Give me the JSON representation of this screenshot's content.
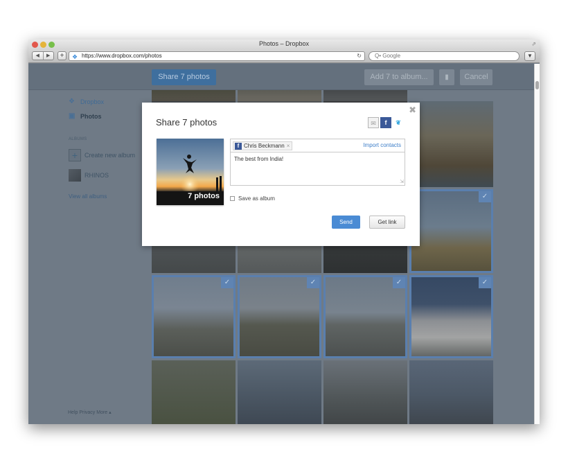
{
  "window": {
    "title": "Photos – Dropbox",
    "url": "https://www.dropbox.com/photos",
    "search_placeholder": "Q• Google"
  },
  "topbar": {
    "share_label": "Share 7 photos",
    "add_album_label": "Add 7 to album...",
    "cancel_label": "Cancel"
  },
  "sidebar": {
    "dropbox_label": "Dropbox",
    "photos_label": "Photos",
    "albums_heading": "ALBUMS",
    "create_album_label": "Create new album",
    "album_name": "RHINOS",
    "view_all_label": "View all albums",
    "footer": "Help  Privacy  More  ▴"
  },
  "modal": {
    "title": "Share 7 photos",
    "photo_caption": "7 photos",
    "recipient": "Chris Beckmann",
    "import_contacts": "Import contacts",
    "message": "The best from India!",
    "save_album_label": "Save as album",
    "send_label": "Send",
    "get_link_label": "Get link"
  },
  "colors": {
    "accent": "#4a8bd4",
    "facebook": "#3b5998",
    "twitter": "#39a9e0",
    "selection": "#5a7fae"
  }
}
